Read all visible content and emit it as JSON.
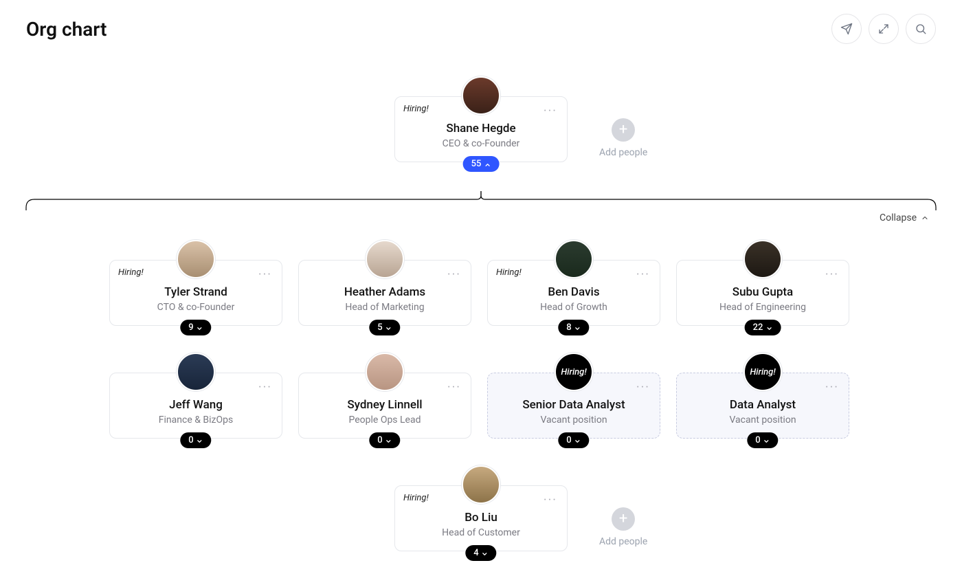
{
  "page": {
    "title": "Org chart",
    "collapse_label": "Collapse",
    "add_people_label": "Add people"
  },
  "hiring_badge": "Hiring!",
  "root": {
    "name": "Shane Hegde",
    "role": "CEO & co-Founder",
    "hiring": true,
    "count": "55",
    "count_open": true
  },
  "row1": [
    {
      "name": "Tyler Strand",
      "role": "CTO & co-Founder",
      "hiring": true,
      "count": "9",
      "vacant": false
    },
    {
      "name": "Heather Adams",
      "role": "Head of Marketing",
      "hiring": false,
      "count": "5",
      "vacant": false
    },
    {
      "name": "Ben Davis",
      "role": "Head of Growth",
      "hiring": true,
      "count": "8",
      "vacant": false
    },
    {
      "name": "Subu Gupta",
      "role": "Head of Engineering",
      "hiring": false,
      "count": "22",
      "vacant": false
    }
  ],
  "row2": [
    {
      "name": "Jeff Wang",
      "role": "Finance & BizOps",
      "hiring": false,
      "count": "0",
      "vacant": false
    },
    {
      "name": "Sydney Linnell",
      "role": "People Ops Lead",
      "hiring": false,
      "count": "0",
      "vacant": false
    },
    {
      "name": "Senior Data Analyst",
      "role": "Vacant position",
      "hiring": true,
      "count": "0",
      "vacant": true
    },
    {
      "name": "Data Analyst",
      "role": "Vacant position",
      "hiring": true,
      "count": "0",
      "vacant": true
    }
  ],
  "row3": {
    "name": "Bo Liu",
    "role": "Head of Customer",
    "hiring": true,
    "count": "4"
  }
}
